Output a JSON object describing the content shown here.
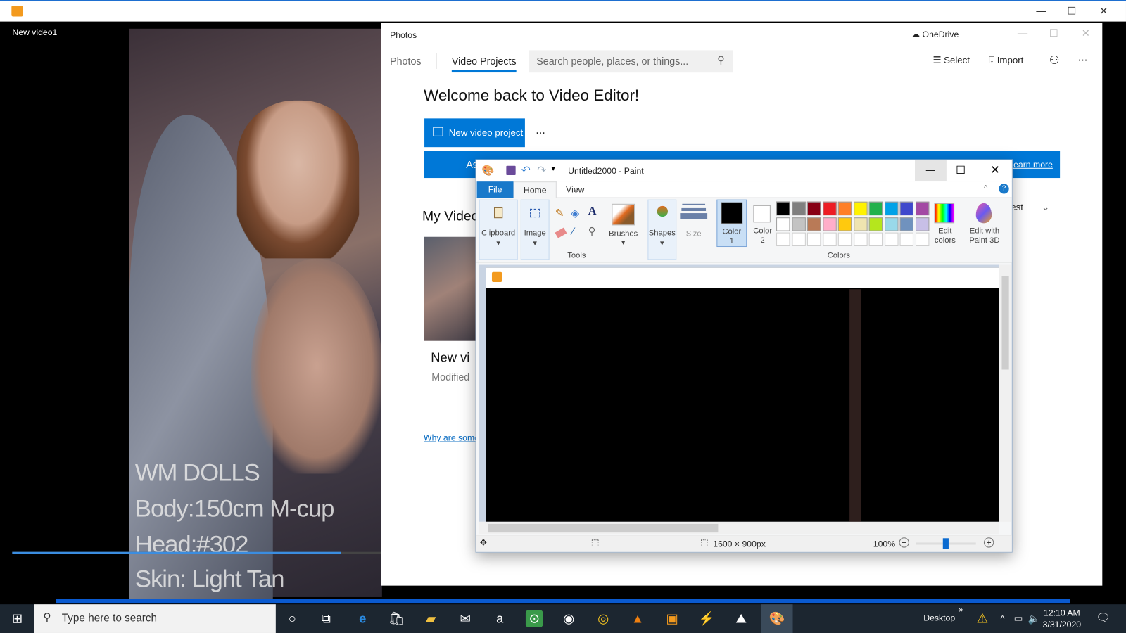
{
  "player": {
    "name": "New video1",
    "overlay": [
      "WM DOLLS",
      "Body:150cm M-cup",
      "Head:#302",
      "Skin: Light Tan"
    ],
    "seek_progress": 0.89
  },
  "photos": {
    "title": "Photos",
    "onedrive": "OneDrive",
    "tabs": [
      "Photos",
      "Video Projects"
    ],
    "active_tab": "Video Projects",
    "search_placeholder": "Search people, places, or things...",
    "select": "Select",
    "import": "Import",
    "more": "...",
    "welcome": "Welcome back to Video Editor!",
    "new_project": "New video project",
    "banner_left": "As",
    "banner_link": "Learn more",
    "my_videos": "My Videos",
    "sort_partial": "vest",
    "card_title": "New vi",
    "card_sub": "Modified",
    "why_link": "Why are some"
  },
  "paint": {
    "title": "Untitled2000 - Paint",
    "tabs": [
      "File",
      "Home",
      "View"
    ],
    "groups": {
      "clipboard": "Clipboard",
      "image": "Image",
      "tools": "Tools",
      "brushes": "Brushes",
      "shapes": "Shapes",
      "size": "Size",
      "color1": "Color 1",
      "color2": "Color 2",
      "edit_colors": "Edit colors",
      "paint3d": "Edit with Paint 3D",
      "colors": "Colors"
    },
    "palette_row1": [
      "#000000",
      "#7f7f7f",
      "#880015",
      "#ed1c24",
      "#ff7f27",
      "#fff200",
      "#22b14c",
      "#00a2e8",
      "#3f48cc",
      "#a349a4"
    ],
    "palette_row2": [
      "#ffffff",
      "#c3c3c3",
      "#b97a57",
      "#ffaec9",
      "#ffc90e",
      "#efe4b0",
      "#b5e61d",
      "#99d9ea",
      "#7092be",
      "#c8bfe7"
    ],
    "color1": "#000000",
    "color2": "#ffffff",
    "dimensions": "1600 × 900px",
    "zoom": "100%",
    "zoom_level": 0.5
  },
  "taskbar": {
    "search_placeholder": "Type here to search",
    "desktop": "Desktop",
    "time": "12:10 AM",
    "date": "3/31/2020"
  }
}
